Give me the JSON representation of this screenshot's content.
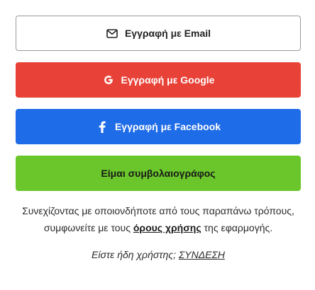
{
  "buttons": {
    "email": {
      "label": "Εγγραφή με Email",
      "icon": "envelope-icon"
    },
    "google": {
      "label": "Εγγραφή με Google",
      "icon": "google-icon",
      "color": "#e84137"
    },
    "facebook": {
      "label": "Εγγραφή με Facebook",
      "icon": "facebook-icon",
      "color": "#1f6ce8"
    },
    "notary": {
      "label": "Είμαι συμβολαιογράφος",
      "color": "#6ac62a"
    }
  },
  "terms": {
    "before": "Συνεχίζοντας με οποιονδήποτε από τους παραπάνω τρόπους, συμφωνείτε με τους ",
    "link": "όρους χρήσης",
    "after": " της εφαρμογής."
  },
  "login": {
    "prompt": "Είστε ήδη χρήστης; ",
    "link": "ΣΥΝΔΕΣΗ"
  }
}
